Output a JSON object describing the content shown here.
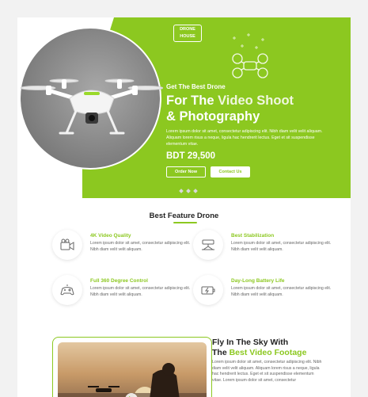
{
  "colors": {
    "accent": "#8cc820",
    "text_dark": "#222222",
    "text_muted": "#666666"
  },
  "logo": {
    "line1": "DRONE",
    "line2": "HOUSE"
  },
  "hero": {
    "kicker": "Get The Best Drone",
    "title_prefix": "For The ",
    "title_highlight": "Video Shoot",
    "title_line2": "& Photography",
    "description": "Lorem ipsum dolor sit amet, consectetur adipiscing elit. Nibh diam velit velit aliquam. Aliquam lorem risus a neque, ligula hac hendrerit lectus. Eget et sit suspendisse elementum vitae.",
    "price": "BDT 29,500",
    "order_label": "Order Now",
    "contact_label": "Contact Us",
    "slide_dots": 4,
    "active_slide": 1
  },
  "features_section": {
    "title_prefix": "Best ",
    "title_highlight": "Feature",
    "title_suffix": " Drone",
    "items": [
      {
        "icon": "video-camera-icon",
        "title": "4K Video Quality",
        "text": "Lorem ipsum dolor sit amet, consectetur adipiscing elit. Nibh diam velit velit aliquam."
      },
      {
        "icon": "stabilization-icon",
        "title": "Best Stabilization",
        "text": "Lorem ipsum dolor sit amet, consectetur adipiscing elit. Nibh diam velit velit aliquam."
      },
      {
        "icon": "controller-icon",
        "title": "Full 360 Degree Control",
        "text": "Lorem ipsum dolor sit amet, consectetur adipiscing elit. Nibh diam velit velit aliquam."
      },
      {
        "icon": "battery-icon",
        "title": "Day-Long Battery Life",
        "text": "Lorem ipsum dolor sit amet, consectetur adipiscing elit. Nibh diam velit velit aliquam."
      }
    ]
  },
  "video_section": {
    "title_line1": "Fly In The Sky With",
    "title_prefix": "The ",
    "title_highlight": "Best Video Footage",
    "text": "Lorem ipsum dolor sit amet, consectetur adipiscing elit. Nibh diam velit velit aliquam. Aliquam lorem risus a neque, ligula hac hendrerit lectus. Eget et sit suspendisse elementum vitae. Lorem ipsum dolor sit amet, consectetur"
  }
}
